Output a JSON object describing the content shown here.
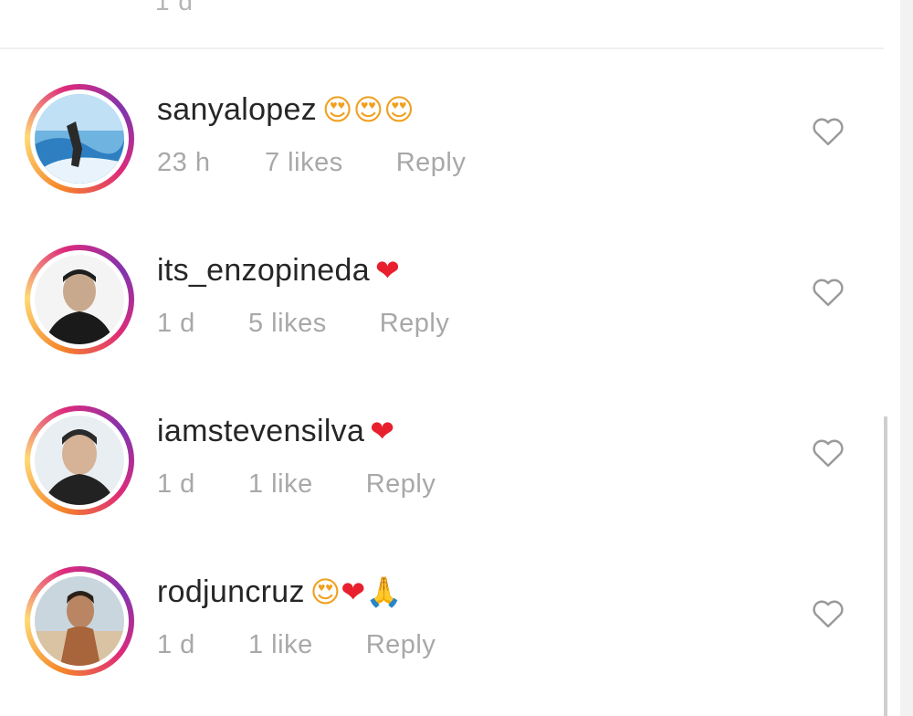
{
  "top_fragment": "1 d",
  "comments": [
    {
      "username": "sanyalopez",
      "emojis": [
        {
          "glyph": "😍",
          "kind": "face"
        },
        {
          "glyph": "😍",
          "kind": "face"
        },
        {
          "glyph": "😍",
          "kind": "face"
        }
      ],
      "time": "23 h",
      "likes": "7 likes",
      "reply": "Reply"
    },
    {
      "username": "its_enzopineda",
      "emojis": [
        {
          "glyph": "❤",
          "kind": "heart"
        }
      ],
      "time": "1 d",
      "likes": "5 likes",
      "reply": "Reply"
    },
    {
      "username": "iamstevensilva",
      "emojis": [
        {
          "glyph": "❤",
          "kind": "heart"
        }
      ],
      "time": "1 d",
      "likes": "1 like",
      "reply": "Reply"
    },
    {
      "username": "rodjuncruz",
      "emojis": [
        {
          "glyph": "😍",
          "kind": "face"
        },
        {
          "glyph": "❤",
          "kind": "heart"
        },
        {
          "glyph": "🙏",
          "kind": "pray"
        }
      ],
      "time": "1 d",
      "likes": "1 like",
      "reply": "Reply"
    }
  ],
  "icons": {
    "avatar_ring": "instagram-story-ring",
    "like": "heart-outline-icon"
  },
  "colors": {
    "username": "#262626",
    "meta": "#a8a8a8",
    "heart_emoji": "#e8202e",
    "ring_orange": "#f58529",
    "ring_pink": "#dd2a7b",
    "ring_purple": "#8134af"
  }
}
